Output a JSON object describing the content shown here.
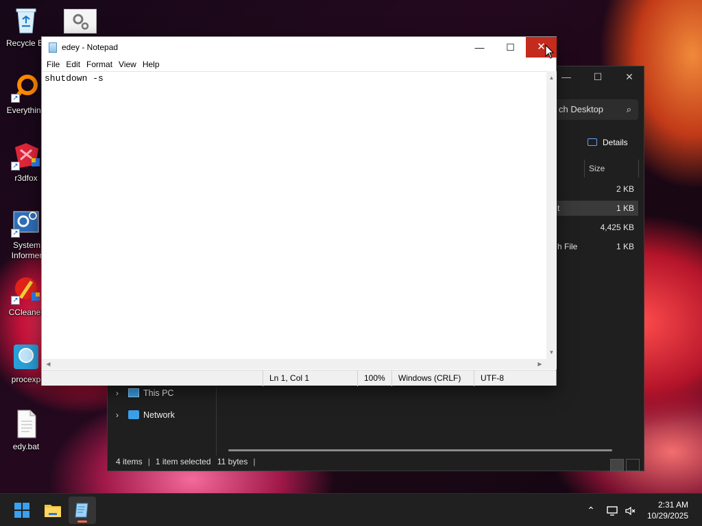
{
  "desktop": {
    "icons": [
      {
        "label": "Recycle Bin",
        "icon": "recycle-bin-icon"
      },
      {
        "label": "Everything",
        "icon": "everything-search-icon"
      },
      {
        "label": "r3dfox",
        "icon": "r3dfox-browser-icon"
      },
      {
        "label": "System Informer",
        "icon": "system-informer-icon"
      },
      {
        "label": "CCleaner",
        "icon": "ccleaner-icon"
      },
      {
        "label": "procexp",
        "icon": "process-explorer-icon"
      },
      {
        "label": "edy.bat",
        "icon": "batch-file-icon"
      }
    ],
    "settings_icon": "gear-icon"
  },
  "explorer": {
    "search_placeholder": "ch Desktop",
    "details_label": "Details",
    "column_size": "Size",
    "rows": [
      {
        "type": "",
        "size": "2 KB",
        "selected": false
      },
      {
        "type": "t",
        "size": "1 KB",
        "selected": true
      },
      {
        "type": "",
        "size": "4,425 KB",
        "selected": false
      },
      {
        "type": "h File",
        "size": "1 KB",
        "selected": false
      }
    ],
    "nav": [
      {
        "label": "This PC",
        "icon": "monitor-icon"
      },
      {
        "label": "Network",
        "icon": "network-icon"
      }
    ],
    "status": {
      "items": "4 items",
      "selected": "1 item selected",
      "bytes": "11 bytes"
    }
  },
  "notepad": {
    "title": "edey - Notepad",
    "menu": [
      "File",
      "Edit",
      "Format",
      "View",
      "Help"
    ],
    "content": "shutdown -s",
    "status": {
      "position": "Ln 1, Col 1",
      "zoom": "100%",
      "line_ending": "Windows (CRLF)",
      "encoding": "UTF-8"
    }
  },
  "taskbar": {
    "clock_time": "2:31 AM",
    "clock_date": "10/29/2025",
    "apps": [
      "start-icon",
      "file-explorer-icon",
      "notepad-icon"
    ],
    "accent": "#ff6b52"
  },
  "colors": {
    "close_hover": "#c42b1c",
    "explorer_bg": "#1f1f1f",
    "taskbar_bg": "#202020"
  }
}
